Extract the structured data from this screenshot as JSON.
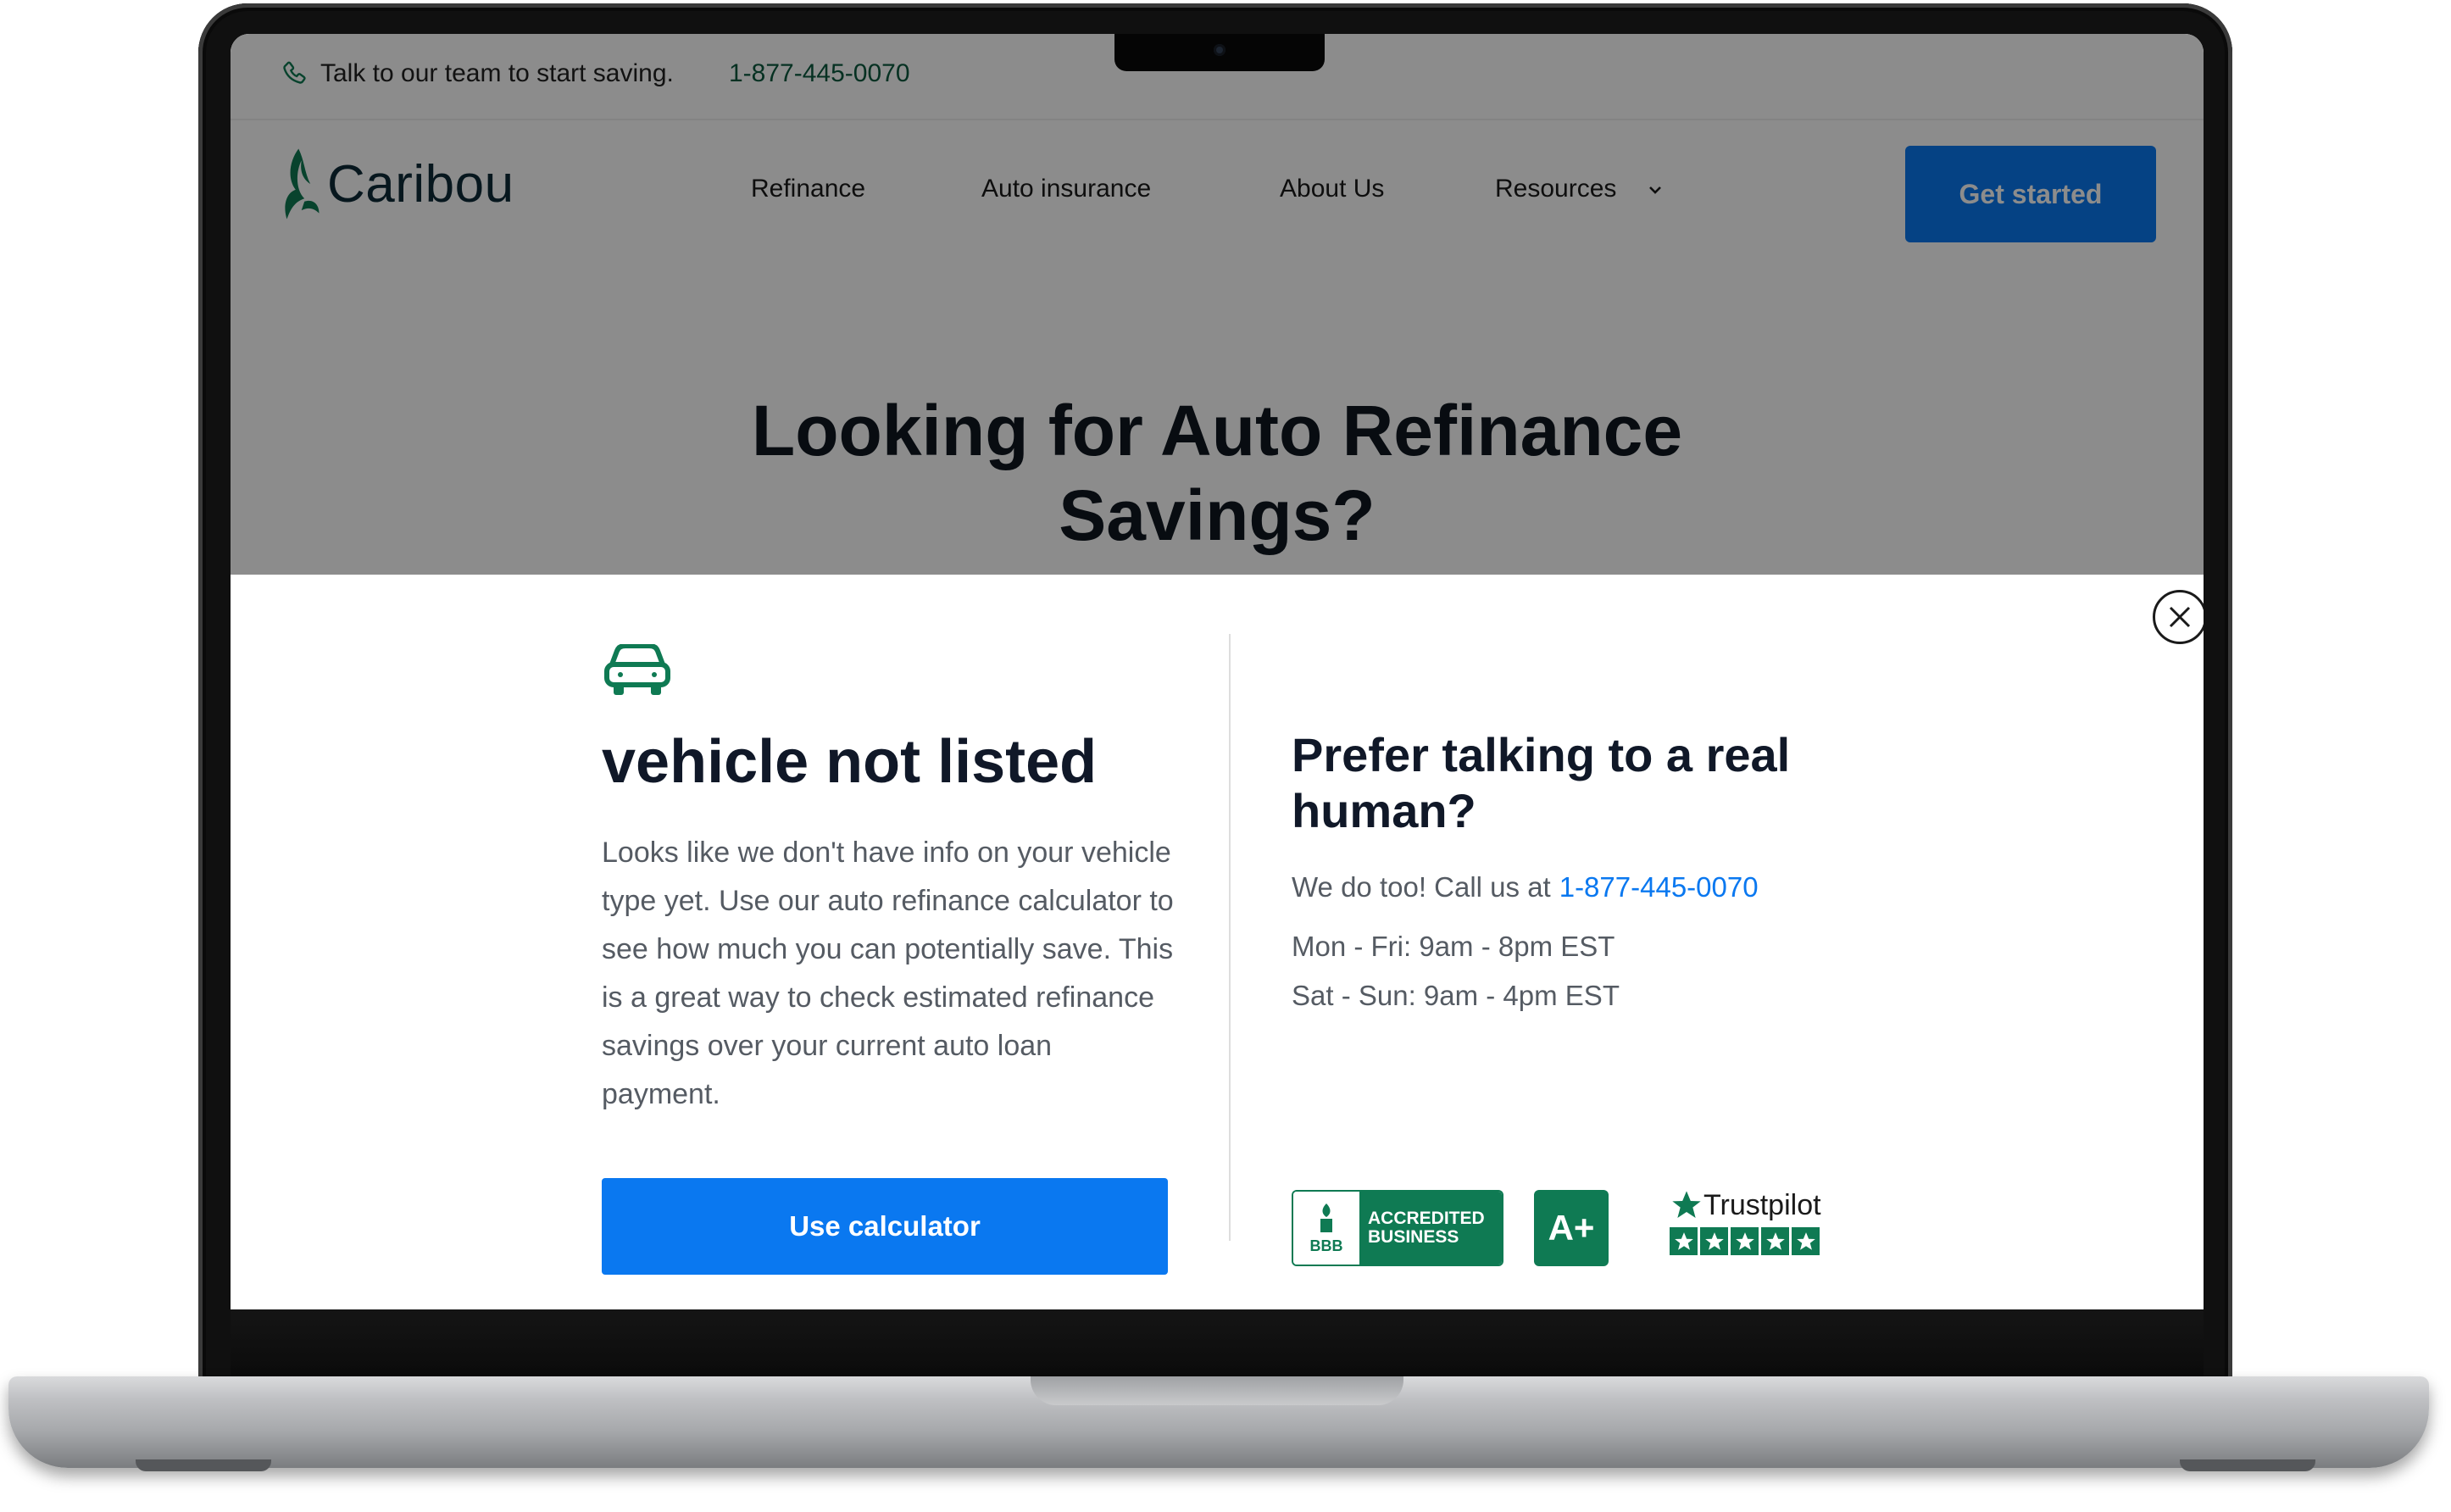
{
  "topbar": {
    "talk_text": "Talk to our team to start saving.",
    "phone": "1-877-445-0070"
  },
  "header": {
    "logo_text": "Caribou",
    "nav": [
      {
        "label": "Refinance"
      },
      {
        "label": "Auto insurance"
      },
      {
        "label": "About Us"
      },
      {
        "label": "Resources"
      }
    ],
    "cta_label": "Get started"
  },
  "hero": {
    "title_line1": "Looking for Auto Refinance",
    "title_line2": "Savings?"
  },
  "modal": {
    "title": "vehicle not listed",
    "body": "Looks like we don't have info on your vehicle type yet. Use our auto refinance calculator to see how much you can potentially save. This is a great way to check estimated refinance savings over your current auto loan payment.",
    "button_label": "Use calculator",
    "right": {
      "title": "Prefer talking to a real human?",
      "call_text": "We do too! Call us at",
      "phone": "1-877-445-0070",
      "hours_weekday": "Mon - Fri: 9am - 8pm EST",
      "hours_weekend": "Sat - Sun: 9am - 4pm EST"
    },
    "badges": {
      "bbb_short": "BBB",
      "bbb_line1": "ACCREDITED",
      "bbb_line2": "BUSINESS",
      "rating": "A+",
      "trustpilot": "Trustpilot"
    }
  },
  "colors": {
    "brand_green": "#0f7a53",
    "accent_blue": "#0a78f0",
    "heading_dark": "#101828"
  }
}
